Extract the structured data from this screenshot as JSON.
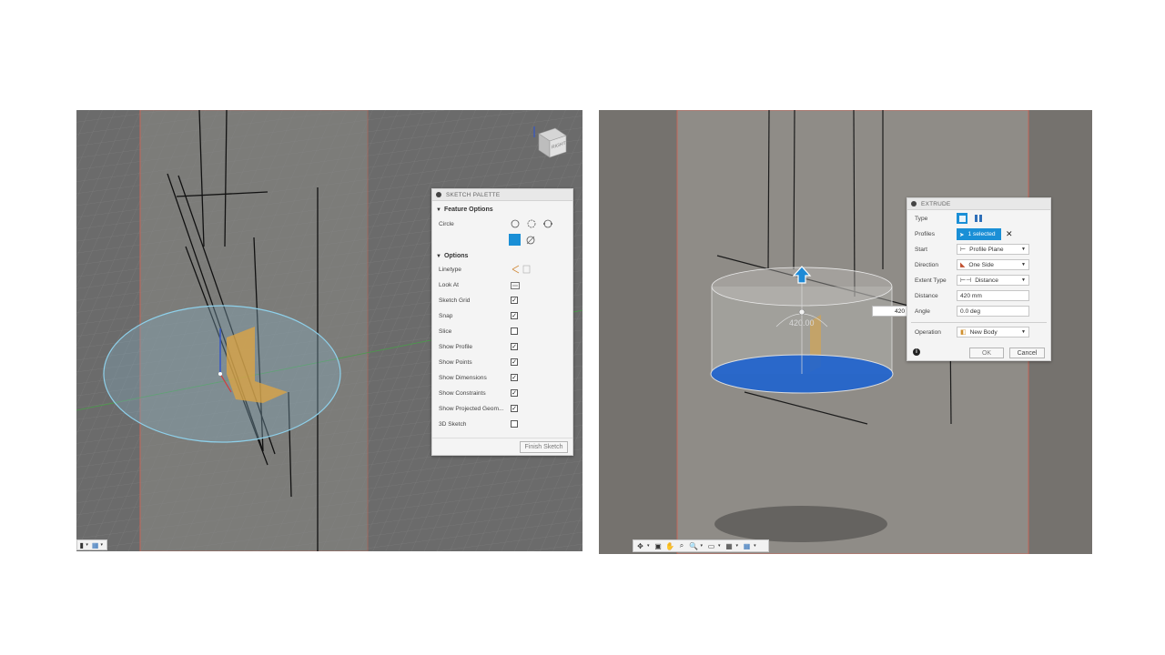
{
  "sketch_palette": {
    "title": "SKETCH PALETTE",
    "feature_options_heading": "Feature Options",
    "circle_label": "Circle",
    "options_heading": "Options",
    "rows": [
      {
        "label": "Linetype",
        "control": "linetype"
      },
      {
        "label": "Look At",
        "control": "lookat"
      },
      {
        "label": "Sketch Grid",
        "checked": true
      },
      {
        "label": "Snap",
        "checked": true
      },
      {
        "label": "Slice",
        "checked": false
      },
      {
        "label": "Show Profile",
        "checked": true
      },
      {
        "label": "Show Points",
        "checked": true
      },
      {
        "label": "Show Dimensions",
        "checked": true
      },
      {
        "label": "Show Constraints",
        "checked": true
      },
      {
        "label": "Show Projected Geom...",
        "checked": true
      },
      {
        "label": "3D Sketch",
        "checked": false
      }
    ],
    "finish_label": "Finish Sketch"
  },
  "extrude": {
    "title": "EXTRUDE",
    "type_label": "Type",
    "profiles_label": "Profiles",
    "profiles_value": "1 selected",
    "start_label": "Start",
    "start_value": "Profile Plane",
    "direction_label": "Direction",
    "direction_value": "One Side",
    "extent_label": "Extent Type",
    "extent_value": "Distance",
    "distance_label": "Distance",
    "distance_value": "420 mm",
    "angle_label": "Angle",
    "angle_value": "0.0 deg",
    "operation_label": "Operation",
    "operation_value": "New Body",
    "ok_label": "OK",
    "cancel_label": "Cancel"
  },
  "viewport_right": {
    "dimension_input_value": "420",
    "dimension_label": "420.00"
  },
  "viewcube": {
    "face_label": "RIGHT"
  },
  "colors": {
    "accent_blue": "#1a8fd6",
    "profile_blue": "#1e63d0",
    "sketch_plane_red": "#d06a5a",
    "body_yellow": "#e0a640"
  }
}
